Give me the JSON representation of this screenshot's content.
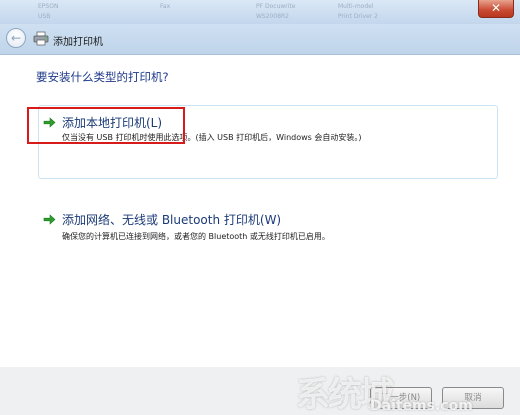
{
  "window": {
    "title": "添加打印机",
    "close_glyph": "✕",
    "background_columns": [
      "EPSON",
      "Fax",
      "PF Docuwrite",
      "Multi-model",
      "USB",
      "WS2008R2",
      "Print Driver 2"
    ]
  },
  "nav": {
    "back_glyph": "←"
  },
  "main": {
    "heading": "要安装什么类型的打印机?",
    "options": [
      {
        "title": "添加本地打印机(L)",
        "description": "仅当没有 USB 打印机时使用此选项。(插入 USB 打印机后，Windows 会自动安装。)"
      },
      {
        "title": "添加网络、无线或 Bluetooth 打印机(W)",
        "description": "确保您的计算机已连接到网络，或者您的 Bluetooth 或无线打印机已启用。"
      }
    ]
  },
  "footer": {
    "next_label": "下一步(N)",
    "cancel_label": "取消"
  },
  "watermark": {
    "text": "系统城",
    "sub": "Daitems.com"
  },
  "colors": {
    "accent": "#1b3a78",
    "highlight": "#d71a1a",
    "arrow": "#2f9e2f"
  }
}
